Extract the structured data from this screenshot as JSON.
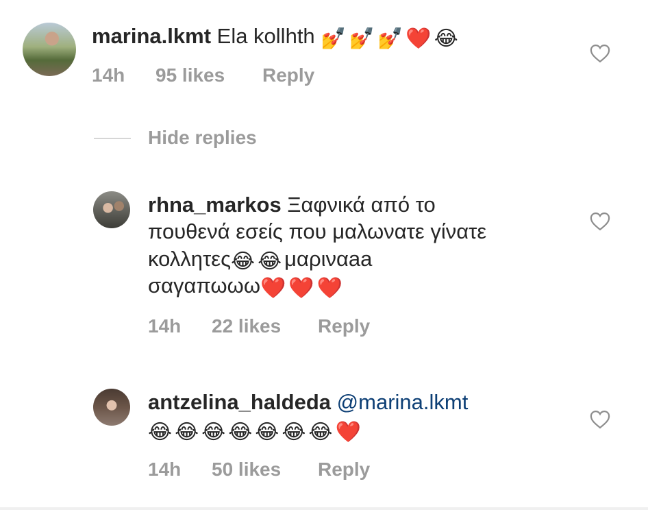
{
  "comments": [
    {
      "username": "marina.lkmt",
      "text": "Ela kollhth",
      "emojis": [
        "💅",
        "💅",
        "💅",
        "❤️",
        "😂"
      ],
      "time": "14h",
      "likes": "95 likes",
      "reply": "Reply"
    },
    {
      "username": "rhna_markos",
      "line1": "Ξαφνικά από το",
      "line2": "πουθενά εσείς που μαλωνατε γίνατε",
      "line3a": "κολλητες",
      "line3b": "μαριναaa",
      "line4": "σαγαπωωω",
      "emojis_line3": [
        "😂",
        "😂"
      ],
      "emojis_line4": [
        "❤️",
        "❤️",
        "❤️"
      ],
      "time": "14h",
      "likes": "22 likes",
      "reply": "Reply"
    },
    {
      "username": "antzelina_haldeda",
      "mention": "@marina.lkmt",
      "emojis": [
        "😂",
        "😂",
        "😂",
        "😂",
        "😂",
        "😂",
        "😂",
        "❤️"
      ],
      "time": "14h",
      "likes": "50 likes",
      "reply": "Reply"
    }
  ],
  "hide_replies": "Hide replies",
  "icons": {
    "like": "heart-outline-icon"
  },
  "colors": {
    "meta": "#9b9b9b",
    "mention": "#0d3f75",
    "text": "#262626"
  }
}
